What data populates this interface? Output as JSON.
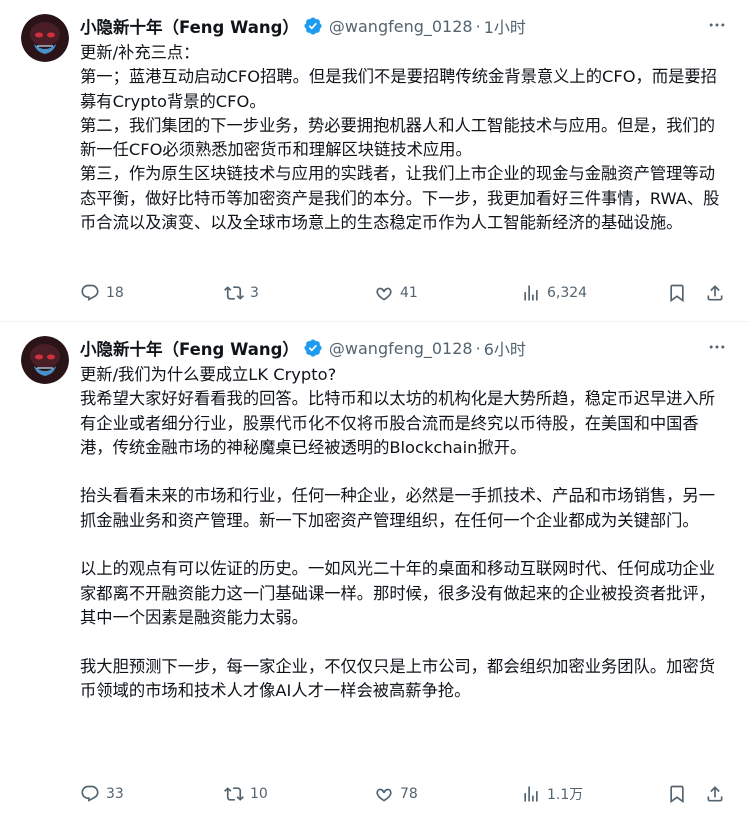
{
  "tweets": [
    {
      "author_name": "小隐新十年（Feng Wang）",
      "handle": "@wangfeng_0128",
      "separator": "·",
      "time": "1小时",
      "text": "更新/补充三点：\n第一；蓝港互动启动CFO招聘。但是我们不是要招聘传统金背景意义上的CFO，而是要招募有Crypto背景的CFO。\n第二，我们集团的下一步业务，势必要拥抱机器人和人工智能技术与应用。但是，我们的新一任CFO必须熟悉加密货币和理解区块链技术应用。\n第三，作为原生区块链技术与应用的实践者，让我们上市企业的现金与金融资产管理等动态平衡，做好比特币等加密资产是我们的本分。下一步，我更加看好三件事情，RWA、股币合流以及演变、以及全球市场意上的生态稳定币作为人工智能新经济的基础设施。",
      "replies": "18",
      "reposts": "3",
      "likes": "41",
      "views": "6,324"
    },
    {
      "author_name": "小隐新十年（Feng Wang）",
      "handle": "@wangfeng_0128",
      "separator": "·",
      "time": "6小时",
      "text": "更新/我们为什么要成立LK Crypto?\n我希望大家好好看看我的回答。比特币和以太坊的机构化是大势所趋，稳定币迟早进入所有企业或者细分行业，股票代币化不仅将币股合流而是终究以币待股，在美国和中国香港，传统金融市场的神秘魔桌已经被透明的Blockchain掀开。\n\n抬头看看未来的市场和行业，任何一种企业，必然是一手抓技术、产品和市场销售，另一抓金融业务和资产管理。新一下加密资产管理组织，在任何一个企业都成为关键部门。\n\n以上的观点有可以佐证的历史。一如风光二十年的桌面和移动互联网时代、任何成功企业家都离不开融资能力这一门基础课一样。那时候，很多没有做起来的企业被投资者批评，其中一个因素是融资能力太弱。\n\n我大胆预测下一步，每一家企业，不仅仅只是上市公司，都会组织加密业务团队。加密货币领域的市场和技术人才像AI人才一样会被高薪争抢。",
      "replies": "33",
      "reposts": "10",
      "likes": "78",
      "views": "1.1万"
    }
  ],
  "icons": {
    "verified": "verified-badge-icon",
    "more": "more-dots-icon",
    "reply": "reply-icon",
    "repost": "repost-icon",
    "like": "heart-icon",
    "views": "views-bar-chart-icon",
    "bookmark": "bookmark-icon",
    "share": "share-icon"
  },
  "colors": {
    "verified": "#1d9bf0",
    "text": "#0f1419",
    "muted": "#536471",
    "divider": "#eff3f4"
  }
}
